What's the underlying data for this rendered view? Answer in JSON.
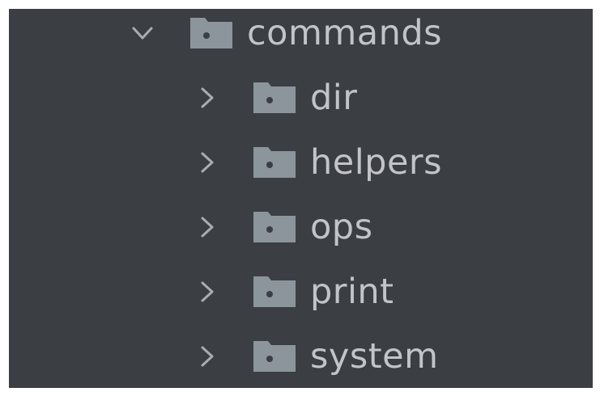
{
  "tree": {
    "root": {
      "label": "commands",
      "expanded": true,
      "icon": "folder-icon"
    },
    "children": [
      {
        "label": "dir",
        "expanded": false,
        "icon": "folder-icon"
      },
      {
        "label": "helpers",
        "expanded": false,
        "icon": "folder-icon"
      },
      {
        "label": "ops",
        "expanded": false,
        "icon": "folder-icon"
      },
      {
        "label": "print",
        "expanded": false,
        "icon": "folder-icon"
      },
      {
        "label": "system",
        "expanded": false,
        "icon": "folder-icon"
      }
    ]
  },
  "colors": {
    "background": "#3b3e42",
    "text": "#c2c4c7",
    "folder": "#8c959c",
    "chevron": "#a9adb1"
  }
}
